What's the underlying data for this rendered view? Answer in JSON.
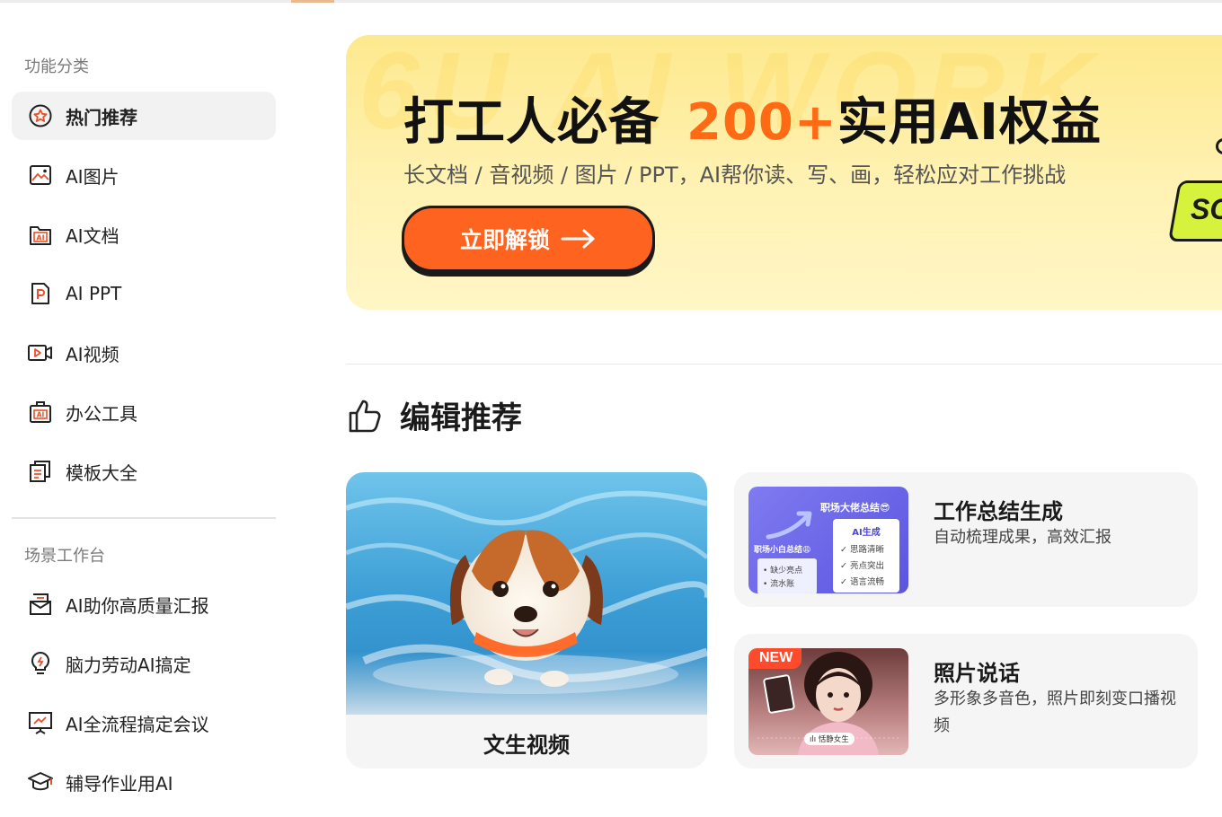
{
  "sidebar": {
    "section1_title": "功能分类",
    "section2_title": "场景工作台",
    "items": [
      {
        "label": "热门推荐",
        "icon": "star-badge-icon"
      },
      {
        "label": "AI图片",
        "icon": "image-icon"
      },
      {
        "label": "AI文档",
        "icon": "ai-document-icon"
      },
      {
        "label": "AI PPT",
        "icon": "ppt-icon"
      },
      {
        "label": "AI视频",
        "icon": "video-icon"
      },
      {
        "label": "办公工具",
        "icon": "ai-toolbox-icon"
      },
      {
        "label": "模板大全",
        "icon": "template-icon"
      }
    ],
    "scenes": [
      {
        "label": "AI助你高质量汇报",
        "icon": "report-icon"
      },
      {
        "label": "脑力劳动AI搞定",
        "icon": "lightbulb-icon"
      },
      {
        "label": "AI全流程搞定会议",
        "icon": "presentation-board-icon"
      },
      {
        "label": "辅导作业用AI",
        "icon": "graduation-cap-icon"
      }
    ]
  },
  "banner": {
    "watermark": "6U AI WORK",
    "title_prefix": "打工人必备",
    "title_highlight": "200+",
    "title_suffix": "实用AI权益",
    "subtitle": "长文档 / 音视频 / 图片 / PPT，AI帮你读、写、画，轻松应对工作挑战",
    "cta_label": "立即解锁",
    "deco_text": "SO"
  },
  "editor": {
    "title": "编辑推荐",
    "video_card": {
      "caption": "文生视频"
    },
    "cards": [
      {
        "title": "工作总结生成",
        "desc": "自动梳理成果，高效汇报",
        "thumb": {
          "heading": "职场大佬总结😎",
          "ai_label": "AI生成",
          "ai_items": [
            "思路清晰",
            "亮点突出",
            "语言流畅"
          ],
          "small_heading": "职场小白总结😩",
          "small_items": [
            "缺少亮点",
            "流水账"
          ]
        }
      },
      {
        "title": "照片说话",
        "desc": "多形象多音色，照片即刻变口播视频",
        "thumb": {
          "badge": "NEW",
          "voice_label": "恬静女生"
        }
      }
    ]
  },
  "colors": {
    "accent": "#ff6320",
    "highlight": "#ff6a14",
    "banner_bg": "#fdeb98",
    "card_bg": "#f5f5f5"
  }
}
